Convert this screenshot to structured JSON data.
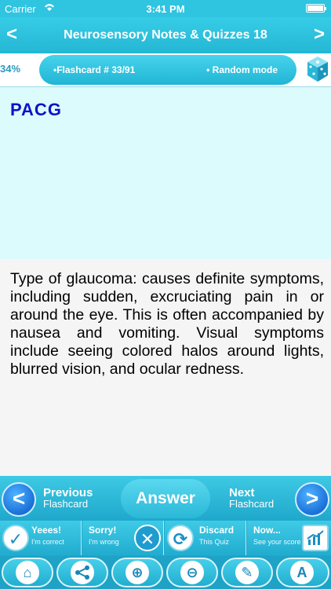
{
  "status_bar": {
    "carrier": "Carrier",
    "time": "3:41 PM"
  },
  "nav": {
    "back_icon": "chevron-left-icon",
    "forward_icon": "chevron-right-icon",
    "title": "Neurosensory Notes & Quizzes 18"
  },
  "info": {
    "progress_label": "34%",
    "flashcard_label": "•Flashcard #  33/91",
    "mode_label": "• Random mode",
    "dice_icon": "dice-icon"
  },
  "card": {
    "term": "PACG",
    "definition": "Type of glaucoma: causes definite symptoms, including sudden, excruciating pain in or around the eye. This is often accompanied by nausea and vomiting. Visual symptoms include seeing colored halos around lights, blurred vision, and ocular redness."
  },
  "actions": {
    "previous_title": "Previous",
    "previous_sub": "Flashcard",
    "answer_label": "Answer",
    "next_title": "Next",
    "next_sub": "Flashcard"
  },
  "feedback": {
    "correct_title": "Yeees!",
    "correct_sub": "I'm correct",
    "wrong_title": "Sorry!",
    "wrong_sub": "I'm wrong",
    "discard_title": "Discard",
    "discard_sub": "This Quiz",
    "score_title": "Now...",
    "score_sub": "See your score"
  },
  "toolbar": {
    "icons": [
      "home-icon",
      "share-icon",
      "zoom-in-icon",
      "zoom-out-icon",
      "bookmark-icon",
      "font-icon"
    ]
  },
  "colors": {
    "accent": "#24b7d5",
    "term_color": "#1010c8",
    "term_bg": "#dcfbfd"
  }
}
